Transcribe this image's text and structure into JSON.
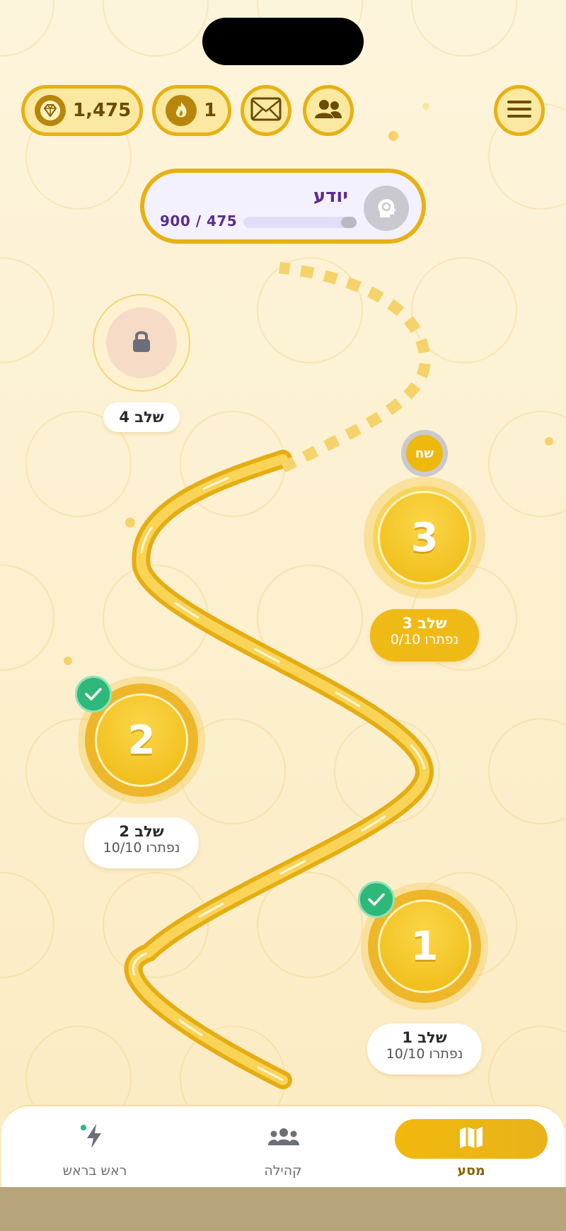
{
  "top_bar": {
    "gems_count": "1,475",
    "streak_count": "1",
    "icons": [
      "gem-icon",
      "flame-icon",
      "mail-icon",
      "friends-icon",
      "menu-icon"
    ]
  },
  "rank": {
    "title": "יודע",
    "progress_text": "900 / 475",
    "progress_fraction": 0.14
  },
  "levels": [
    {
      "number": "1",
      "label": "שלב 1",
      "status": "10/10 נפתרו",
      "completed": true
    },
    {
      "number": "2",
      "label": "שלב 2",
      "status": "10/10 נפתרו",
      "completed": true
    },
    {
      "number": "3",
      "label": "שלב 3",
      "status": "0/10 נפתרו",
      "completed": false,
      "badge": "שח"
    },
    {
      "label": "שלב 4",
      "locked": true
    }
  ],
  "bottom_nav": {
    "journey": "מסע",
    "community": "קהילה",
    "head_to_head": "ראש בראש"
  },
  "colors": {
    "accent": "#eeb90f",
    "rank_text": "#5a2d8c",
    "success": "#2eb87a",
    "background": "#fdf3d6"
  }
}
